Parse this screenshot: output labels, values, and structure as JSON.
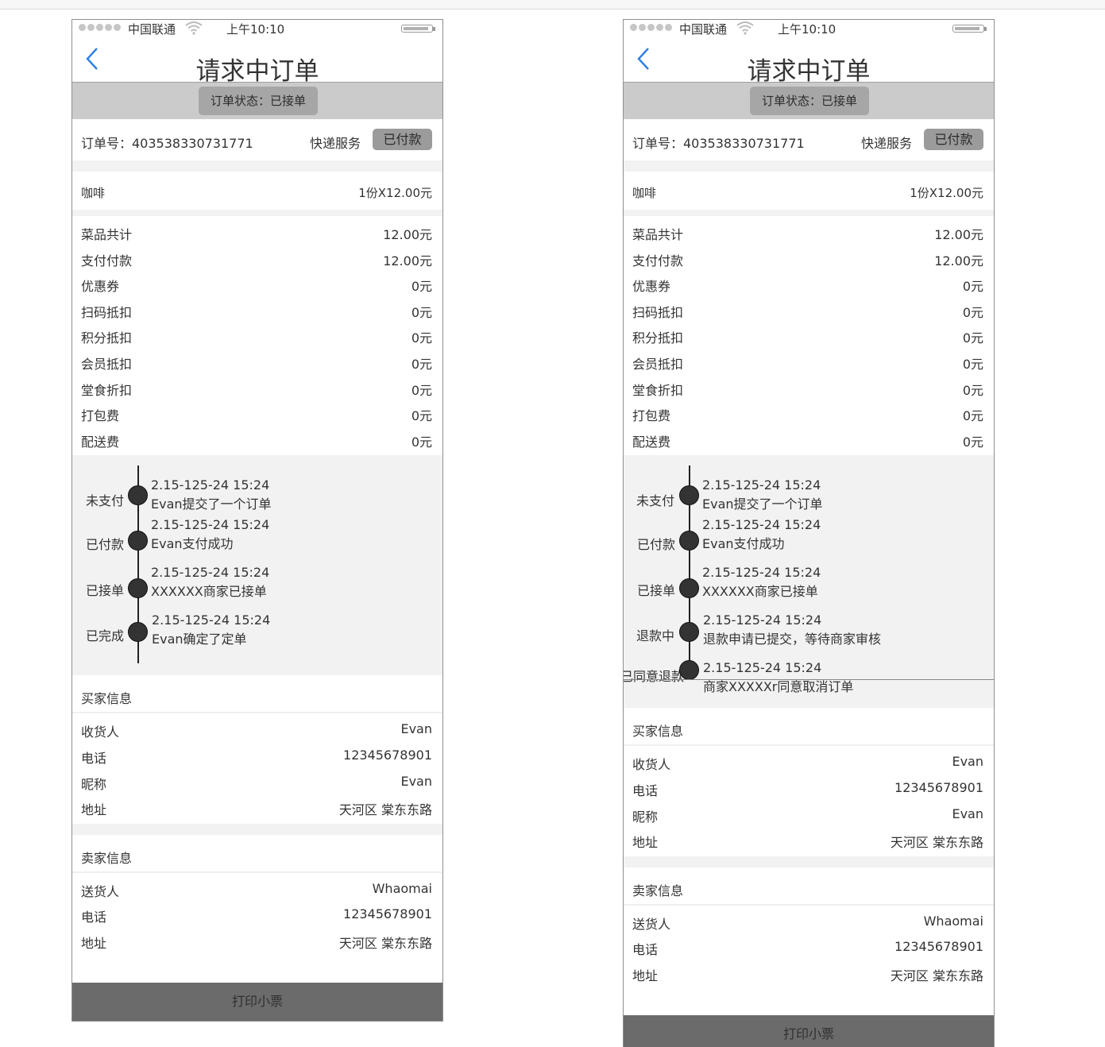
{
  "screens": [
    {
      "status_bar": {
        "carrier": "中国联通",
        "time": "上午10:10"
      },
      "nav_title": "请求中订单",
      "order_status": "订单状态：已接单",
      "order": {
        "number_text": "订单号：403538330731771",
        "service": "快递服务",
        "payment_status": "已付款"
      },
      "item": {
        "name": "咖啡",
        "qty_price": "1份X12.00元"
      },
      "fees": [
        {
          "label": "菜品共计",
          "value": "12.00元"
        },
        {
          "label": "支付付款",
          "value": "12.00元"
        },
        {
          "label": "优惠券",
          "value": "0元"
        },
        {
          "label": "扫码抵扣",
          "value": "0元"
        },
        {
          "label": "积分抵扣",
          "value": "0元"
        },
        {
          "label": "会员抵扣",
          "value": "0元"
        },
        {
          "label": "堂食折扣",
          "value": "0元"
        },
        {
          "label": "打包费",
          "value": "0元"
        },
        {
          "label": "配送费",
          "value": "0元"
        }
      ],
      "timeline": [
        {
          "state": "未支付",
          "time": "2.15-125-24 15:24",
          "desc": "Evan提交了一个订单"
        },
        {
          "state": "已付款",
          "time": "2.15-125-24 15:24",
          "desc": "Evan支付成功"
        },
        {
          "state": "已接单",
          "time": "2.15-125-24 15:24",
          "desc": "XXXXXX商家已接单"
        },
        {
          "state": "已完成",
          "time": "2.15-125-24 15:24",
          "desc": "Evan确定了定单"
        }
      ],
      "buyer": {
        "title": "买家信息",
        "rows": [
          {
            "label": "收货人",
            "value": "Evan"
          },
          {
            "label": "电话",
            "value": "12345678901"
          },
          {
            "label": "昵称",
            "value": "Evan"
          },
          {
            "label": "地址",
            "value": "天河区 棠东东路"
          }
        ]
      },
      "seller": {
        "title": "卖家信息",
        "rows": [
          {
            "label": "送货人",
            "value": "Whaomai"
          },
          {
            "label": "电话",
            "value": "12345678901"
          },
          {
            "label": "地址",
            "value": "天河区 棠东东路"
          }
        ]
      },
      "print_label": "打印小票"
    },
    {
      "status_bar": {
        "carrier": "中国联通",
        "time": "上午10:10"
      },
      "nav_title": "请求中订单",
      "order_status": "订单状态：已接单",
      "order": {
        "number_text": "订单号：403538330731771",
        "service": "快递服务",
        "payment_status": "已付款"
      },
      "item": {
        "name": "咖啡",
        "qty_price": "1份X12.00元"
      },
      "fees": [
        {
          "label": "菜品共计",
          "value": "12.00元"
        },
        {
          "label": "支付付款",
          "value": "12.00元"
        },
        {
          "label": "优惠券",
          "value": "0元"
        },
        {
          "label": "扫码抵扣",
          "value": "0元"
        },
        {
          "label": "积分抵扣",
          "value": "0元"
        },
        {
          "label": "会员抵扣",
          "value": "0元"
        },
        {
          "label": "堂食折扣",
          "value": "0元"
        },
        {
          "label": "打包费",
          "value": "0元"
        },
        {
          "label": "配送费",
          "value": "0元"
        }
      ],
      "timeline": [
        {
          "state": "未支付",
          "time": "2.15-125-24 15:24",
          "desc": "Evan提交了一个订单"
        },
        {
          "state": "已付款",
          "time": "2.15-125-24 15:24",
          "desc": "Evan支付成功"
        },
        {
          "state": "已接单",
          "time": "2.15-125-24 15:24",
          "desc": "XXXXXX商家已接单"
        },
        {
          "state": "退款中",
          "time": "2.15-125-24 15:24",
          "desc": "退款申请已提交，等待商家审核"
        },
        {
          "state": "已同意退款",
          "time": "2.15-125-24 15:24",
          "desc": "商家XXXXXr同意取消订单"
        }
      ],
      "buyer": {
        "title": "买家信息",
        "rows": [
          {
            "label": "收货人",
            "value": "Evan"
          },
          {
            "label": "电话",
            "value": "12345678901"
          },
          {
            "label": "昵称",
            "value": "Evan"
          },
          {
            "label": "地址",
            "value": "天河区 棠东东路"
          }
        ]
      },
      "seller": {
        "title": "卖家信息",
        "rows": [
          {
            "label": "送货人",
            "value": "Whaomai"
          },
          {
            "label": "电话",
            "value": "12345678901"
          },
          {
            "label": "地址",
            "value": "天河区 棠东东路"
          }
        ]
      },
      "print_label": "打印小票"
    }
  ]
}
